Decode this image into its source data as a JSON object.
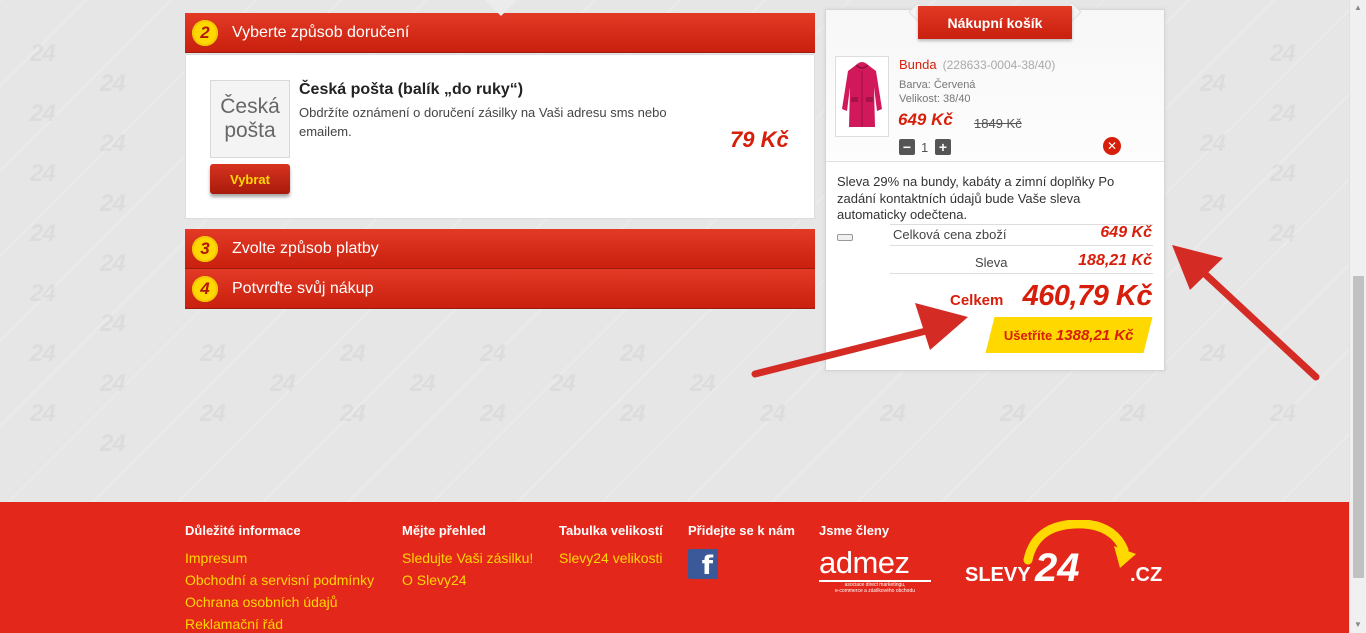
{
  "steps": {
    "step2": {
      "num": "2",
      "label": "Vyberte způsob doručení"
    },
    "step3": {
      "num": "3",
      "label": "Zvolte způsob platby"
    },
    "step4": {
      "num": "4",
      "label": "Potvrďte svůj nákup"
    }
  },
  "delivery": {
    "logo_line1": "Česká",
    "logo_line2": "pošta",
    "title": "Česká pošta (balík „do ruky“)",
    "description": "Obdržíte oznámení o doručení zásilky na Vaši adresu sms nebo emailem.",
    "price": "79 Kč",
    "select_button": "Vybrat"
  },
  "cart": {
    "title": "Nákupní košík",
    "item": {
      "name": "Bunda",
      "code": "(228633-0004-38/40)",
      "color": "Barva: Červená",
      "size": "Velikost: 38/40",
      "price": "649 Kč",
      "old_price": "1849 Kč",
      "quantity": "1",
      "minus": "−",
      "plus": "+",
      "remove": "✕"
    },
    "note": "Sleva 29% na bundy, kabáty a zimní doplňky Po zadání kontaktních údajů bude Vaše sleva automaticky odečtena.",
    "goods_total_label": "Celková cena zboží",
    "goods_total_value": "649 Kč",
    "discount_label": "Sleva",
    "discount_value": "188,21 Kč",
    "total_label": "Celkem",
    "total_value": "460,79 Kč",
    "saving_label": "Ušetříte",
    "saving_value": "1388,21 Kč"
  },
  "footer": {
    "col1": {
      "heading": "Důležité informace",
      "links": [
        "Impresum",
        "Obchodní a servisní podmínky",
        "Ochrana osobních údajů",
        "Reklamační řád"
      ]
    },
    "col2": {
      "heading": "Mějte přehled",
      "links": [
        "Sledujte Vaši zásilku!",
        "O Slevy24"
      ]
    },
    "col3": {
      "heading": "Tabulka velikostí",
      "links": [
        "Slevy24 velikosti"
      ]
    },
    "col4": {
      "heading": "Přidejte se k nám",
      "icon": "facebook-icon"
    },
    "col5": {
      "heading": "Jsme členy",
      "admez_word": "admez",
      "admez_sub1": "asociace direct marketingu,",
      "admez_sub2": "e-commerce a zásilkového obchodu"
    },
    "brand": {
      "left": "SLEVY",
      "num": "24",
      "domain": ".CZ"
    }
  },
  "colors": {
    "brand_red": "#e3271a",
    "accent_yellow": "#ffd800",
    "price_red": "#d71e0a"
  }
}
